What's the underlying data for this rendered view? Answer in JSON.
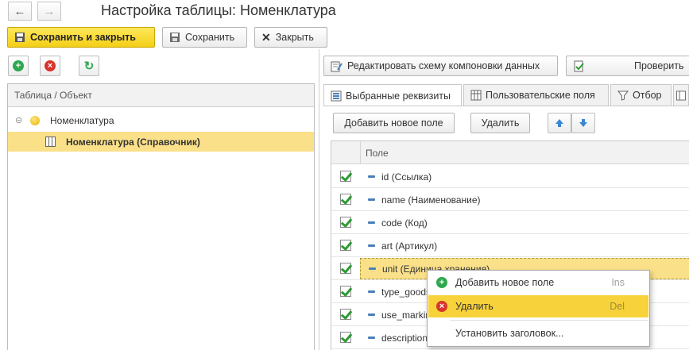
{
  "window": {
    "title": "Настройка таблицы: Номенклатура"
  },
  "toolbar": {
    "save_close_label": "Сохранить и закрыть",
    "save_label": "Сохранить",
    "close_label": "Закрыть"
  },
  "left_panel": {
    "column_header": "Таблица / Объект",
    "tree": [
      {
        "label": "Номенклатура",
        "expanded": true
      },
      {
        "label": "Номенклатура (Справочник)",
        "selected": true
      }
    ]
  },
  "right_toolbar": {
    "edit_schema_label": "Редактировать схему компоновки данных",
    "check_label": "Проверить"
  },
  "tabs": [
    {
      "label": "Выбранные реквизиты",
      "active": true
    },
    {
      "label": "Пользовательские поля"
    },
    {
      "label": "Отбор"
    }
  ],
  "fields_toolbar": {
    "add_field_label": "Добавить новое поле",
    "delete_label": "Удалить"
  },
  "grid": {
    "column_header": "Поле",
    "rows": [
      {
        "label": "id (Ссылка)",
        "checked": true
      },
      {
        "label": "name (Наименование)",
        "checked": true
      },
      {
        "label": "code (Код)",
        "checked": true
      },
      {
        "label": "art (Артикул)",
        "checked": true
      },
      {
        "label": "unit (Единица хранения)",
        "checked": true,
        "selected": true
      },
      {
        "label": "type_goods",
        "checked": true
      },
      {
        "label": "use_marking",
        "checked": true
      },
      {
        "label": "description",
        "checked": true
      }
    ]
  },
  "context_menu": {
    "items": [
      {
        "label": "Добавить новое поле",
        "shortcut": "Ins"
      },
      {
        "label": "Удалить",
        "shortcut": "Del",
        "highlighted": true
      },
      {
        "label": "Установить заголовок..."
      }
    ]
  },
  "colors": {
    "accent_yellow": "#f3cf17",
    "selection": "#fbe08a",
    "check_green": "#2e9a34",
    "add_green": "#2fa84f",
    "delete_red": "#d9342b"
  }
}
